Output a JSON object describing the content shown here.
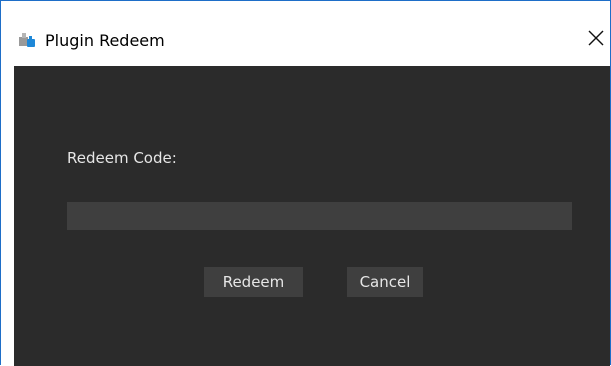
{
  "window": {
    "title": "Plugin Redeem",
    "icon": "puzzle-plugin-icon",
    "close_glyph": "✕"
  },
  "form": {
    "label": "Redeem Code:",
    "code_value": "",
    "code_placeholder": ""
  },
  "buttons": {
    "redeem_label": "Redeem",
    "cancel_label": "Cancel"
  },
  "colors": {
    "content_background": "#2b2b2b",
    "control_background": "#3f3f3f",
    "text": "#e6e6e6",
    "window_border": "#1e6ec8"
  }
}
